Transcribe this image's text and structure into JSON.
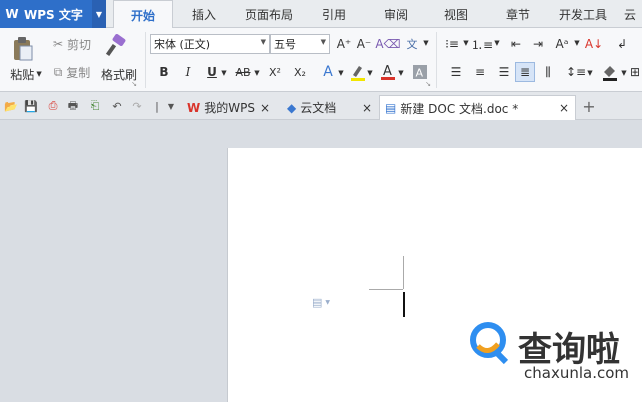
{
  "app": {
    "title": "WPS 文字",
    "logo_text": "W"
  },
  "menu": [
    "开始",
    "插入",
    "页面布局",
    "引用",
    "审阅",
    "视图",
    "章节",
    "开发工具",
    "云"
  ],
  "ribbon": {
    "paste_label": "粘贴",
    "cut_label": "剪切",
    "copy_label": "复制",
    "format_painter_label": "格式刷",
    "font_name": "宋体 (正文)",
    "font_size": "五号",
    "bold": "B",
    "italic": "I",
    "underline": "U",
    "strikethrough": "AB",
    "superscript": "X²",
    "subscript": "X₂",
    "grow_font": "A⁺",
    "shrink_font": "A⁻",
    "font_color": "A",
    "text_effect": "A"
  },
  "tabs": [
    {
      "label": "我的WPS"
    },
    {
      "label": "云文档"
    },
    {
      "label": "新建 DOC 文档.doc *"
    }
  ],
  "watermark": {
    "name": "查询啦",
    "url": "chaxunla.com"
  },
  "colors": {
    "accent": "#2e6fc9",
    "wps_red": "#d9342b",
    "watermark_blue": "#2e8ef0",
    "watermark_orange": "#f0a020"
  }
}
